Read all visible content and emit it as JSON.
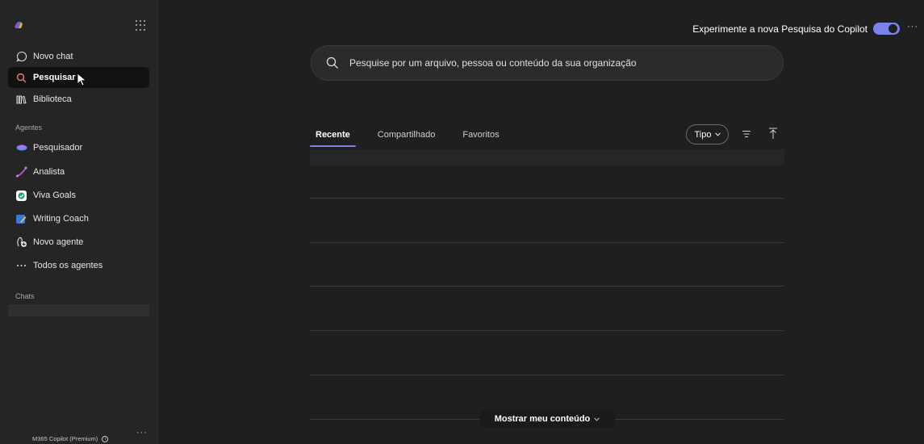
{
  "sidebar": {
    "nav": [
      {
        "label": "Novo chat",
        "icon": "chat-bubble-icon"
      },
      {
        "label": "Pesquisar",
        "icon": "search-icon",
        "active": true
      },
      {
        "label": "Biblioteca",
        "icon": "library-icon"
      }
    ],
    "agents_label": "Agentes",
    "agents": [
      {
        "label": "Pesquisador",
        "icon": "researcher-icon"
      },
      {
        "label": "Analista",
        "icon": "analyst-icon"
      },
      {
        "label": "Viva Goals",
        "icon": "viva-goals-icon"
      },
      {
        "label": "Writing Coach",
        "icon": "writing-coach-icon"
      },
      {
        "label": "Novo agente",
        "icon": "new-agent-icon"
      },
      {
        "label": "Todos os agentes",
        "icon": "more-icon"
      }
    ],
    "chats_label": "Chats",
    "footer_plan": "M365 Copilot (Premium)"
  },
  "topbar": {
    "try_label": "Experimente a nova Pesquisa do Copilot",
    "toggle_on": true
  },
  "search": {
    "placeholder": "Pesquise por um arquivo, pessoa ou conteúdo da sua organização"
  },
  "tabs": [
    {
      "label": "Recente",
      "active": true
    },
    {
      "label": "Compartilhado"
    },
    {
      "label": "Favoritos"
    }
  ],
  "filters": {
    "type_label": "Tipo"
  },
  "show_more": {
    "label": "Mostrar meu conteúdo"
  },
  "colors": {
    "accent": "#7b83eb",
    "background": "#1f1f1f",
    "sidebar": "#252525"
  }
}
